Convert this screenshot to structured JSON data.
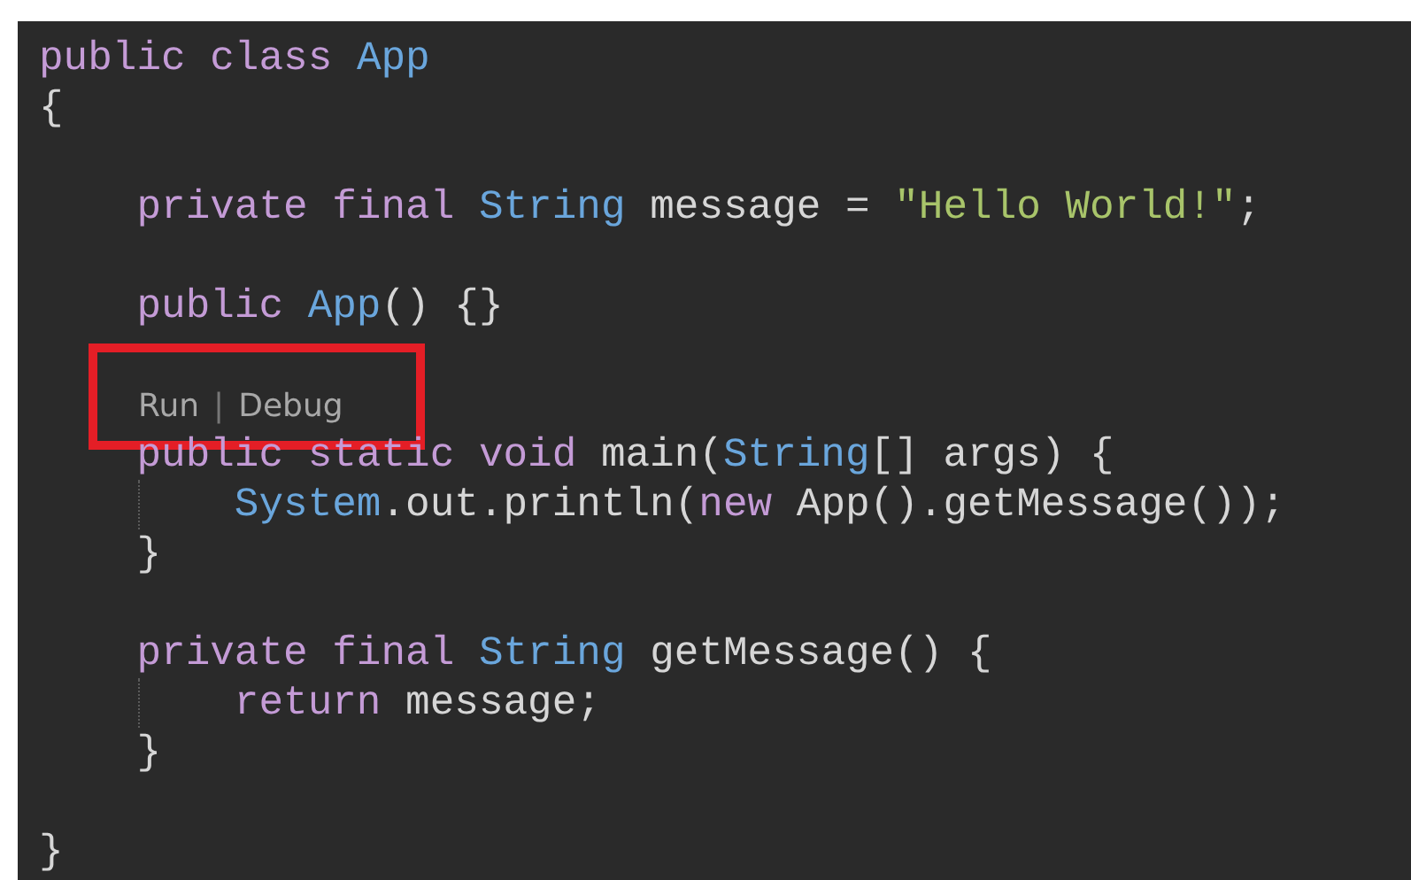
{
  "editor": {
    "lines": [
      {
        "kind": "code",
        "tokens": [
          {
            "text": "public",
            "kind": "keyword"
          },
          {
            "text": " class ",
            "kind": "keyword"
          },
          {
            "text": "App",
            "kind": "type"
          }
        ]
      },
      {
        "kind": "code",
        "tokens": [
          {
            "text": "{",
            "kind": "plain"
          }
        ]
      },
      {
        "kind": "blank"
      },
      {
        "kind": "code",
        "tokens": [
          {
            "text": "    private final ",
            "kind": "keyword"
          },
          {
            "text": "String",
            "kind": "type"
          },
          {
            "text": " message = ",
            "kind": "plain"
          },
          {
            "text": "\"Hello World!\"",
            "kind": "string"
          },
          {
            "text": ";",
            "kind": "plain"
          }
        ]
      },
      {
        "kind": "blank"
      },
      {
        "kind": "code",
        "tokens": [
          {
            "text": "    public ",
            "kind": "keyword"
          },
          {
            "text": "App",
            "kind": "type"
          },
          {
            "text": "() {}",
            "kind": "plain"
          }
        ]
      },
      {
        "kind": "blank"
      },
      {
        "kind": "codelens",
        "highlighted": true,
        "actions": [
          "Run",
          "Debug"
        ],
        "separator": "|"
      },
      {
        "kind": "code",
        "tokens": [
          {
            "text": "    public static void ",
            "kind": "keyword"
          },
          {
            "text": "main(",
            "kind": "plain"
          },
          {
            "text": "String",
            "kind": "type"
          },
          {
            "text": "[] args) {",
            "kind": "plain"
          }
        ]
      },
      {
        "kind": "code",
        "guide": true,
        "tokens": [
          {
            "text": "        System",
            "kind": "type"
          },
          {
            "text": ".out.println(",
            "kind": "plain"
          },
          {
            "text": "new ",
            "kind": "keyword"
          },
          {
            "text": "App().getMessage());",
            "kind": "plain"
          }
        ]
      },
      {
        "kind": "code",
        "tokens": [
          {
            "text": "    }",
            "kind": "plain"
          }
        ]
      },
      {
        "kind": "blank"
      },
      {
        "kind": "code",
        "tokens": [
          {
            "text": "    private final ",
            "kind": "keyword"
          },
          {
            "text": "String",
            "kind": "type"
          },
          {
            "text": " getMessage() {",
            "kind": "plain"
          }
        ]
      },
      {
        "kind": "code",
        "guide": true,
        "tokens": [
          {
            "text": "        return ",
            "kind": "keyword"
          },
          {
            "text": "message;",
            "kind": "plain"
          }
        ]
      },
      {
        "kind": "code",
        "tokens": [
          {
            "text": "    }",
            "kind": "plain"
          }
        ]
      },
      {
        "kind": "blank"
      },
      {
        "kind": "code",
        "tokens": [
          {
            "text": "}",
            "kind": "plain"
          }
        ]
      }
    ]
  }
}
